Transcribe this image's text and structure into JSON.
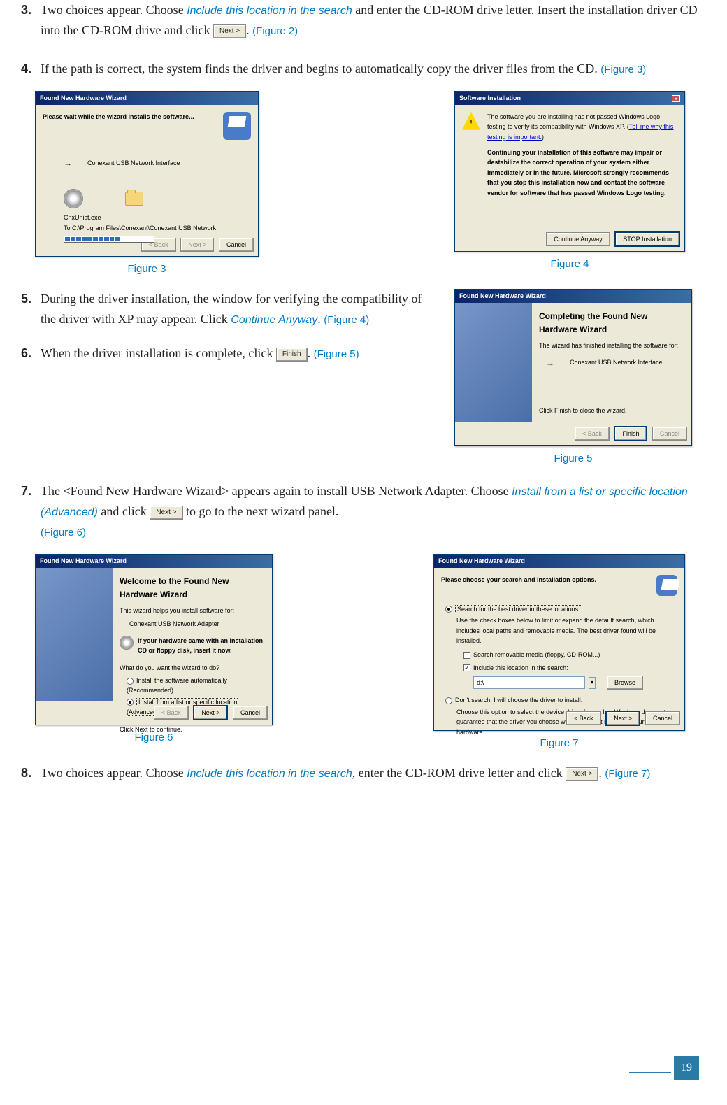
{
  "steps": {
    "s3": {
      "num": "3.",
      "text_a": "Two choices appear. Choose ",
      "action": "Include this location in the search",
      "text_b": " and enter the CD-ROM drive letter. Insert the installation driver CD into the CD-ROM drive and click ",
      "btn": "Next >",
      "text_c": ". ",
      "figref": "(Figure 2)"
    },
    "s4": {
      "num": "4.",
      "text_a": "If the path is correct, the system finds the driver and begins to automatically copy the driver files from the CD. ",
      "figref": "(Figure 3)"
    },
    "s5": {
      "num": "5.",
      "text_a": "During the driver installation, the window for verifying the compatibility of the driver with XP may appear. Click ",
      "action": "Continue Anyway",
      "text_b": ". ",
      "figref": "(Figure 4)"
    },
    "s6": {
      "num": "6.",
      "text_a": "When the driver installation is complete, click ",
      "btn": "Finish",
      "text_b": ". ",
      "figref": "(Figure 5)"
    },
    "s7": {
      "num": "7.",
      "text_a": "The <Found New Hardware Wizard> appears again to install USB Network Adapter. Choose ",
      "action": "Install from a list or specific location (Advanced)",
      "text_b": " and click ",
      "btn": "Next >",
      "text_c": " to go to the next wizard panel. ",
      "figref": "(Figure 6)"
    },
    "s8": {
      "num": "8.",
      "text_a": "Two choices appear. Choose ",
      "action": "Include this location in the search",
      "text_b": ", enter the CD-ROM drive letter and click ",
      "btn": "Next >",
      "text_c": ". ",
      "figref": "(Figure 7)"
    }
  },
  "captions": {
    "fig3": "Figure 3",
    "fig4": "Figure 4",
    "fig5": "Figure 5",
    "fig6": "Figure 6",
    "fig7": "Figure 7"
  },
  "dialogs": {
    "fig3": {
      "title": "Found New Hardware Wizard",
      "heading": "Please wait while the wizard installs the software...",
      "device": "Conexant USB Network Interface",
      "file": "CnxUnist.exe",
      "path": "To C:\\Program Files\\Conexant\\Conexant USB Network",
      "btn_back": "< Back",
      "btn_next": "Next >",
      "btn_cancel": "Cancel"
    },
    "fig4": {
      "title": "Software Installation",
      "line1": "The software you are installing has not passed Windows Logo testing to verify its compatibility with Windows XP. (",
      "link": "Tell me why this testing is important.",
      "line1b": ")",
      "warn": "Continuing your installation of this software may impair or destabilize the correct operation of your system either immediately or in the future. Microsoft strongly recommends that you stop this installation now and contact the software vendor for software that has passed Windows Logo testing.",
      "btn_continue": "Continue Anyway",
      "btn_stop": "STOP Installation"
    },
    "fig5": {
      "title": "Found New Hardware Wizard",
      "heading": "Completing the Found New Hardware Wizard",
      "sub": "The wizard has finished installing the software for:",
      "device": "Conexant USB Network Interface",
      "closing": "Click Finish to close the wizard.",
      "btn_back": "< Back",
      "btn_finish": "Finish",
      "btn_cancel": "Cancel"
    },
    "fig6": {
      "title": "Found New Hardware Wizard",
      "heading": "Welcome to the Found New Hardware Wizard",
      "sub": "This wizard helps you install software for:",
      "device": "Conexant USB Network Adapter",
      "cd_hint": "If your hardware came with an installation CD or floppy disk, insert it now.",
      "question": "What do you want the wizard to do?",
      "opt1": "Install the software automatically (Recommended)",
      "opt2": "Install from a list or specific location (Advanced)",
      "closing": "Click Next to continue.",
      "btn_back": "< Back",
      "btn_next": "Next >",
      "btn_cancel": "Cancel"
    },
    "fig7": {
      "title": "Found New Hardware Wizard",
      "heading": "Please choose your search and installation options.",
      "opt1": "Search for the best driver in these locations.",
      "opt1_sub": "Use the check boxes below to limit or expand the default search, which includes local paths and removable media. The best driver found will be installed.",
      "chk1": "Search removable media (floppy, CD-ROM...)",
      "chk2": "Include this location in the search:",
      "path": "d:\\",
      "btn_browse": "Browse",
      "opt2": "Don't search. I will choose the driver to install.",
      "opt2_sub": "Choose this option to select the device driver from a list. Windows does not guarantee that the driver you choose will be the best match for your hardware.",
      "btn_back": "< Back",
      "btn_next": "Next >",
      "btn_cancel": "Cancel"
    }
  },
  "page_number": "19"
}
